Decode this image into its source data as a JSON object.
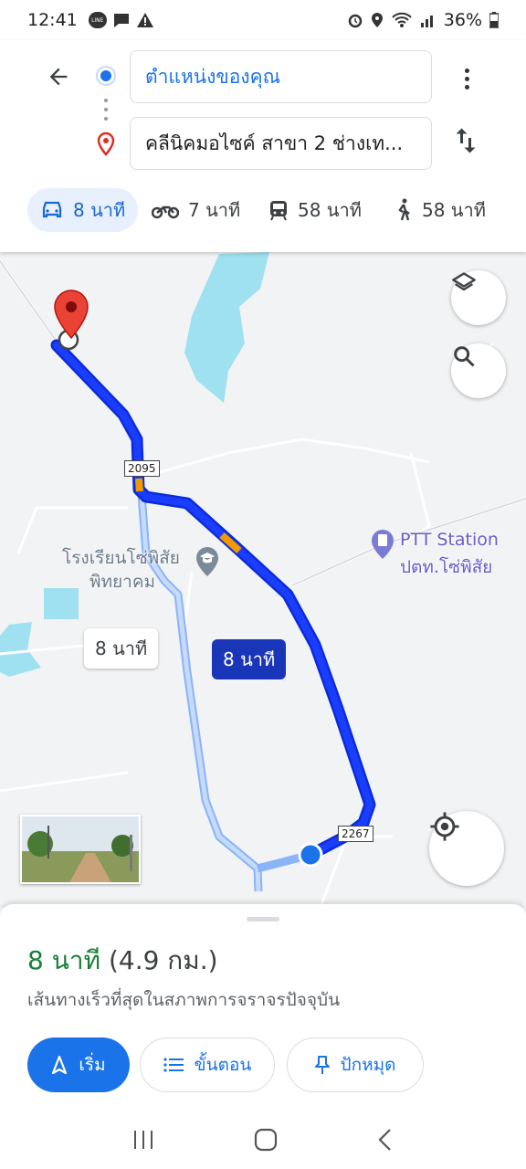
{
  "status_bar": {
    "time": "12:41",
    "battery": "36%"
  },
  "header": {
    "origin": "ตำแหน่งของคุณ",
    "destination": "คลีนิคมอไซค์ สาขา 2 ช่างเท...",
    "modes": [
      {
        "name": "car",
        "label": "8 นาที",
        "active": true
      },
      {
        "name": "motorcycle",
        "label": "7 นาที",
        "active": false
      },
      {
        "name": "transit",
        "label": "58 นาที",
        "active": false
      },
      {
        "name": "walk",
        "label": "58 นาที",
        "active": false
      }
    ]
  },
  "map": {
    "school_label_line1": "โรงเรียนโซ่พิสัย",
    "school_label_line2": "พิทยาคม",
    "ptt_label_line1": "PTT Station",
    "ptt_label_line2": "ปตท.โซ่พิสัย",
    "route_shield_1": "2095",
    "route_shield_2": "2267",
    "alt_route_time": "8 นาที",
    "main_route_time": "8 นาที"
  },
  "sheet": {
    "duration": "8 นาที",
    "distance": "(4.9 กม.)",
    "description": "เส้นทางเร็วที่สุดในสภาพการจราจรปัจจุบัน",
    "start_label": "เริ่ม",
    "steps_label": "ขั้นตอน",
    "pin_label": "ปักหมุด"
  },
  "colors": {
    "accent": "#1a73e8",
    "route": "#1a36ff",
    "duration_green": "#188038"
  }
}
